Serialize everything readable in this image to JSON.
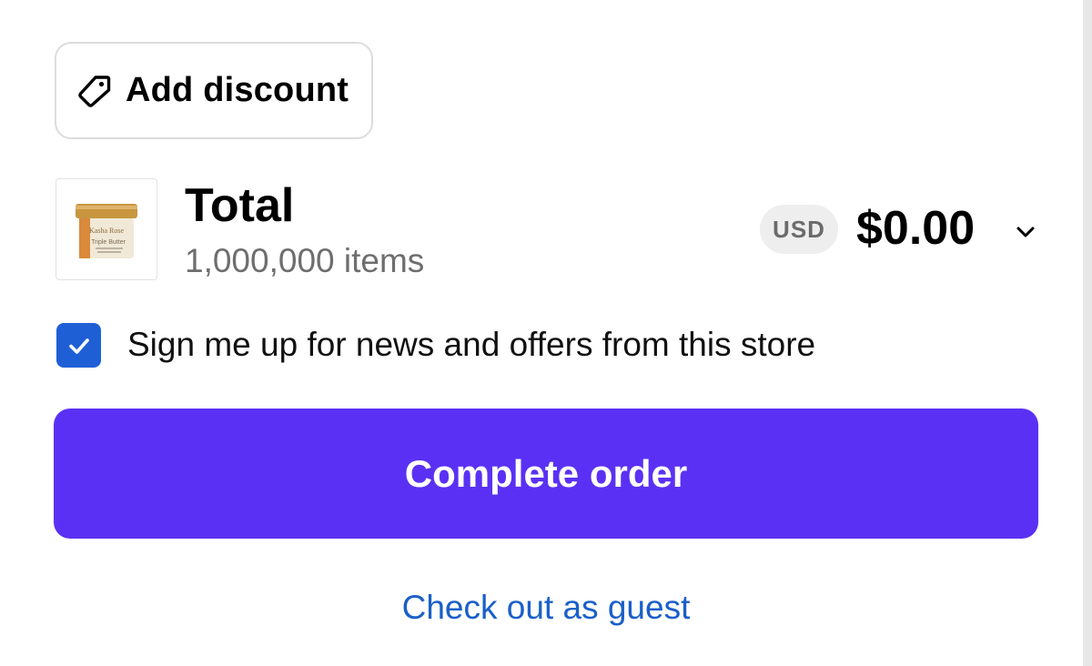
{
  "discount": {
    "label": "Add discount",
    "icon": "tag-icon"
  },
  "summary": {
    "title": "Total",
    "items_text": "1,000,000 items",
    "currency": "USD",
    "price": "$0.00",
    "expand_icon": "chevron-down-icon",
    "product_image": {
      "brand_text": "Kasha Rose",
      "product_text": "Triple Butter"
    }
  },
  "newsletter": {
    "label": "Sign me up for news and offers from this store",
    "checked": true
  },
  "actions": {
    "complete_label": "Complete order",
    "guest_label": "Check out as guest"
  },
  "colors": {
    "primary_button": "#5a31f4",
    "checkbox": "#1f5fd6",
    "link": "#1a5fc8",
    "muted_text": "#6e6e6e"
  }
}
